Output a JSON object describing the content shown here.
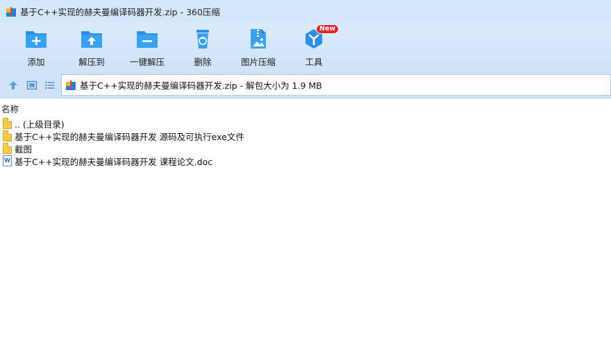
{
  "window": {
    "title": "基于C++实现的赫夫曼编译码器开发.zip - 360压缩"
  },
  "toolbar": {
    "items": [
      {
        "label": "添加",
        "icon": "add-folder-icon"
      },
      {
        "label": "解压到",
        "icon": "extract-to-icon"
      },
      {
        "label": "一键解压",
        "icon": "one-click-extract-icon"
      },
      {
        "label": "删除",
        "icon": "trash-icon"
      },
      {
        "label": "图片压缩",
        "icon": "image-compress-icon"
      },
      {
        "label": "工具",
        "icon": "tools-icon",
        "badge": "New"
      }
    ]
  },
  "address": {
    "path": "基于C++实现的赫夫曼编译码器开发.zip - 解包大小为 1.9 MB"
  },
  "filelist": {
    "column_name": "名称",
    "rows": [
      {
        "name": ".. (上级目录)",
        "icon": "folder-icon"
      },
      {
        "name": "基于C++实现的赫夫曼编译码器开发 源码及可执行exe文件",
        "icon": "folder-icon"
      },
      {
        "name": "截图",
        "icon": "folder-icon"
      },
      {
        "name": "基于C++实现的赫夫曼编译码器开发 课程论文.doc",
        "icon": "word-doc-icon"
      }
    ]
  },
  "colors": {
    "accent": "#2a8fe8",
    "toolbar_bg": "#cfe3f8",
    "badge": "#e8262a"
  }
}
